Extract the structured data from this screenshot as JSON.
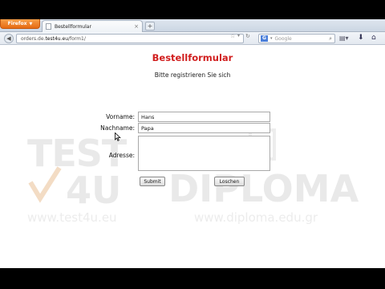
{
  "browser": {
    "app_button_label": "Firefox",
    "tab_title": "Bestellformular",
    "new_tab_label": "+",
    "url_prefix": "orders.de.",
    "url_host": "test4u.eu",
    "url_path": "/form1/",
    "search_placeholder": "Google",
    "search_engine_icon": "G"
  },
  "form": {
    "title": "Bestellformular",
    "subtitle": "Bitte registrieren Sie sich",
    "fields": {
      "vorname_label": "Vorname:",
      "vorname_value": "Hans",
      "nachname_label": "Nachname:",
      "nachname_value": "Papa",
      "adresse_label": "Adresse:",
      "adresse_value": ""
    },
    "buttons": {
      "submit": "Submit",
      "loschen": "Loschen"
    }
  },
  "watermark": {
    "logo_left_top": "TEST",
    "logo_left_bottom": "4U",
    "logo_left_url": "www.test4u.eu",
    "logo_right": "DIPLOMA",
    "logo_right_url": "www.diploma.edu.gr"
  },
  "colors": {
    "title_red": "#d11f1f",
    "firefox_orange": "#e66b12",
    "watermark_grey": "#e8e8e8"
  },
  "icons": [
    "firefox-menu-icon",
    "star-icon",
    "reload-icon",
    "search-icon",
    "bookmarks-icon",
    "download-icon",
    "home-icon",
    "mouse-cursor-icon"
  ]
}
